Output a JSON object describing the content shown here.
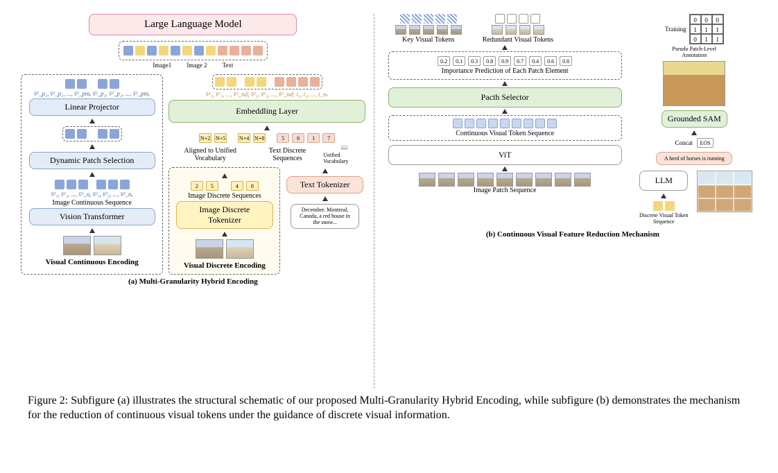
{
  "left": {
    "llm": "Large Language Model",
    "llm_groups": [
      "Image1",
      "Image 2",
      "Text"
    ],
    "projector": "Linear Projector",
    "embedding": "Embeddling Layer",
    "dps": "Dynamic Patch Selection",
    "vit": "Vision Transformer",
    "cont_enc": "Visual Continuous Encoding",
    "disc_enc": "Visual Discrete Encoding",
    "img_disc_seq": "Image Discrete Sequences",
    "img_disc_tok": "Image  Discrete Tokenizer",
    "img_cont_seq": "Image Continuous Sequence",
    "aligned": "Aligned to Unified Vocabulary",
    "txt_disc": "Text Discrete Sequences",
    "txt_tok": "Text Tokenizer",
    "unified": "Unified Vocabulary",
    "txt_sample": "December. Montreal, Canada, a red house in the snow...",
    "proj_syms": "v̄¹_p₁, v̄¹_p₂, ..., v̄¹_pmₑ  v̄²_p₁, v̄²_p₂, ..., v̄²_pmₑ",
    "cont_syms": "v̄¹₁, v̄¹₂, ..., v̄¹_nₑ  v̄²₁, v̄²₂, ..., v̄²_nₑ",
    "embed_syms": "v̂¹₁, v̂¹₂, ..., v̂¹_nd; v̂²₁, v̂²₂, ..., v̂²_nd; t₁, t₂, ..., t_nₜ",
    "align_ids": [
      "N+2",
      "N+5",
      "",
      "N+4",
      "N+8",
      "",
      "5",
      "6",
      "1",
      "7"
    ],
    "disc_ids": [
      "2",
      "5",
      "",
      "4",
      "8"
    ],
    "caption": "(a) Multi-Granularity Hybrid Encoding"
  },
  "right": {
    "key_vt": "Key Visual Tokens",
    "red_vt": "Redundant Visual Tokens",
    "importance_vals": [
      "0.2",
      "0.1",
      "0.3",
      "0.8",
      "0.9",
      "0.7",
      "0.4",
      "0.6",
      "0.8"
    ],
    "importance_label": "Importance Prediction of Each Patch Element",
    "selector": "Pacth Selector",
    "cont_seq": "Continuous Visual Token Sequence",
    "vit": "ViT",
    "img_patch": "Image Patch Sequence",
    "training": "Training",
    "pseudo": "Pseudo Patch-Level Annotation",
    "gsam": "Grounded SAM",
    "llm": "LLM",
    "disc_seq": "Discrete Visual Token Sequence",
    "concat": "Concat",
    "eos": "EOS",
    "text_prompt": "A herd of horses is running",
    "matrix": [
      "0",
      "0",
      "0",
      "1",
      "1",
      "1",
      "0",
      "1",
      "1"
    ],
    "caption": "(b) Continuous Visual Feature Reduction Mechanism"
  },
  "figure_caption": "Figure 2: Subfigure (a) illustrates the structural schematic of our proposed Multi-Granularity Hybrid Encoding, while subfigure (b) demonstrates the mechanism for the reduction of continuous visual tokens under the guidance of discrete visual information."
}
